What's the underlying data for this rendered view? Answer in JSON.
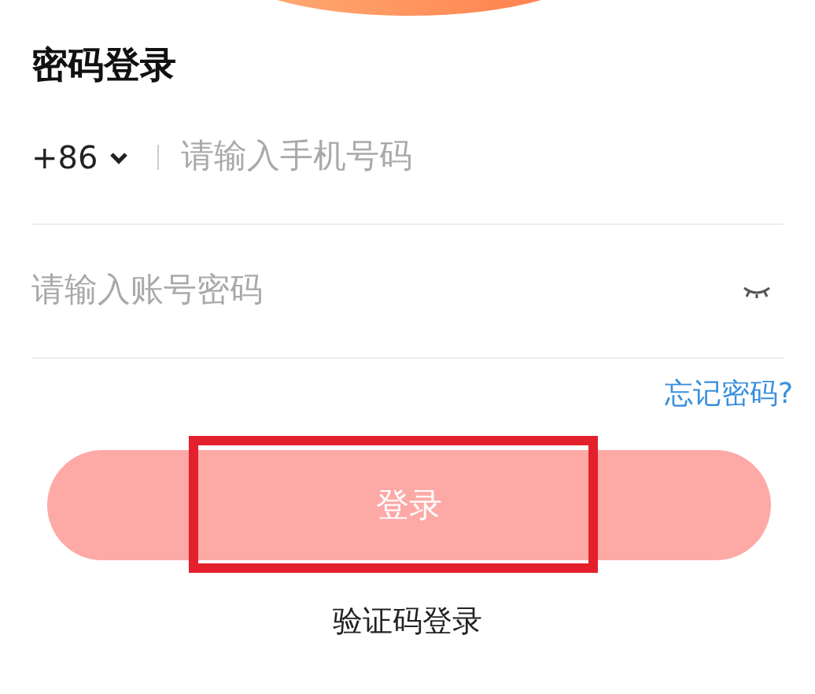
{
  "title": "密码登录",
  "phone": {
    "country_code": "+86",
    "placeholder": "请输入手机号码"
  },
  "password": {
    "placeholder": "请输入账号密码"
  },
  "forgot_link": "忘记密码?",
  "login_button": {
    "label": "登录",
    "highlighted": true
  },
  "alt_login": "验证码登录"
}
